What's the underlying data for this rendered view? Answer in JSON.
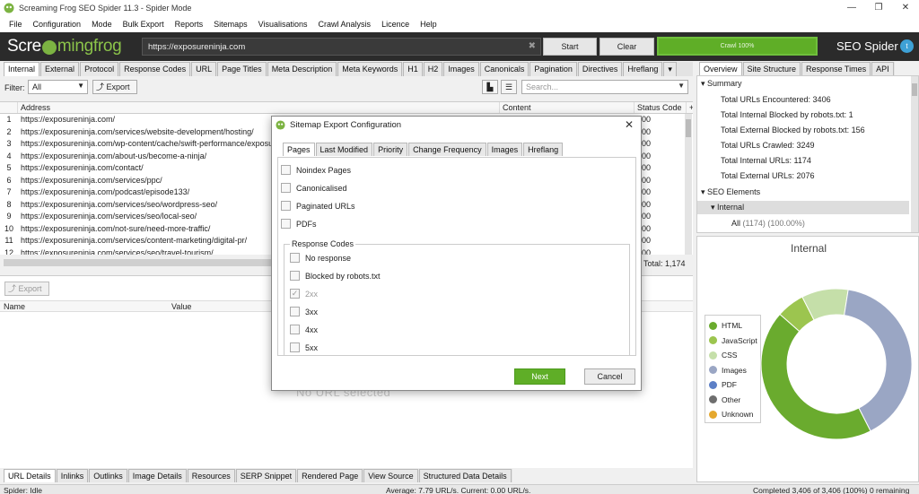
{
  "window": {
    "title": "Screaming Frog SEO Spider 11.3 - Spider Mode",
    "controls": [
      "—",
      "❐",
      "✕"
    ]
  },
  "menu": [
    "File",
    "Configuration",
    "Mode",
    "Bulk Export",
    "Reports",
    "Sitemaps",
    "Visualisations",
    "Crawl Analysis",
    "Licence",
    "Help"
  ],
  "header": {
    "brand_left": "Scre",
    "brand_right": "mingfrog",
    "url": "https://exposureninja.com",
    "start_label": "Start",
    "clear_label": "Clear",
    "progress_label": "Crawl 100%",
    "progress_percent": 100,
    "product_name": "SEO Spider",
    "colors": {
      "accent_green": "#5fae27",
      "header_bg": "#2b2b2b"
    }
  },
  "main_tabs": [
    "Internal",
    "External",
    "Protocol",
    "Response Codes",
    "URL",
    "Page Titles",
    "Meta Description",
    "Meta Keywords",
    "H1",
    "H2",
    "Images",
    "Canonicals",
    "Pagination",
    "Directives",
    "Hreflang"
  ],
  "filter": {
    "label": "Filter:",
    "value": "All",
    "export_label": "Export",
    "search_placeholder": "Search..."
  },
  "table": {
    "columns": [
      "Address",
      "Content",
      "Status Code"
    ],
    "rows": [
      {
        "idx": "1",
        "address": "https://exposureninja.com/",
        "content": "",
        "status": "200"
      },
      {
        "idx": "2",
        "address": "https://exposureninja.com/services/website-development/hosting/",
        "content": "",
        "status": "200"
      },
      {
        "idx": "3",
        "address": "https://exposureninja.com/wp-content/cache/swift-performance/exposureninja.com/",
        "content": "",
        "status": "200"
      },
      {
        "idx": "4",
        "address": "https://exposureninja.com/about-us/become-a-ninja/",
        "content": "",
        "status": "200"
      },
      {
        "idx": "5",
        "address": "https://exposureninja.com/contact/",
        "content": "",
        "status": "200"
      },
      {
        "idx": "6",
        "address": "https://exposureninja.com/services/ppc/",
        "content": "",
        "status": "200"
      },
      {
        "idx": "7",
        "address": "https://exposureninja.com/podcast/episode133/",
        "content": "",
        "status": "200"
      },
      {
        "idx": "8",
        "address": "https://exposureninja.com/services/seo/wordpress-seo/",
        "content": "",
        "status": "200"
      },
      {
        "idx": "9",
        "address": "https://exposureninja.com/services/seo/local-seo/",
        "content": "",
        "status": "200"
      },
      {
        "idx": "10",
        "address": "https://exposureninja.com/not-sure/need-more-traffic/",
        "content": "",
        "status": "200"
      },
      {
        "idx": "11",
        "address": "https://exposureninja.com/services/content-marketing/digital-pr/",
        "content": "",
        "status": "200"
      },
      {
        "idx": "12",
        "address": "https://exposureninja.com/services/seo/travel-tourism/",
        "content": "",
        "status": "200"
      }
    ],
    "total_label": "Total:",
    "total_value": "1,174"
  },
  "lower": {
    "export_label": "Export",
    "col_name": "Name",
    "col_value": "Value",
    "empty_text": "No URL selected"
  },
  "bottom_tabs": [
    "URL Details",
    "Inlinks",
    "Outlinks",
    "Image Details",
    "Resources",
    "SERP Snippet",
    "Rendered Page",
    "View Source",
    "Structured Data Details"
  ],
  "status_bar": {
    "left": "Spider: Idle",
    "middle": "Average: 7.79 URL/s. Current: 0.00 URL/s.",
    "right": "Completed 3,406 of 3,406 (100%) 0 remaining"
  },
  "right_tabs": [
    "Overview",
    "Site Structure",
    "Response Times",
    "API"
  ],
  "overview": {
    "summary_label": "Summary",
    "summary_items": [
      "Total URLs Encountered: 3406",
      "Total Internal Blocked by robots.txt: 1",
      "Total External Blocked by robots.txt: 156",
      "Total URLs Crawled: 3249",
      "Total Internal URLs: 1174",
      "Total External URLs: 2076"
    ],
    "seo_elements_label": "SEO Elements",
    "internal_label": "Internal",
    "all_label": "All",
    "all_count": "(1174) (100.00%)"
  },
  "chart_data": {
    "type": "pie",
    "title": "Internal",
    "categories": [
      "HTML",
      "JavaScript",
      "CSS",
      "Images",
      "PDF",
      "Other",
      "Unknown"
    ],
    "values": [
      44,
      6,
      10,
      40,
      0,
      0,
      0
    ],
    "colors": [
      "#6aab2e",
      "#9cc54f",
      "#c5dfa9",
      "#9aa6c4",
      "#5c7fc6",
      "#6e6e6e",
      "#e5a82e"
    ],
    "legend_position": "left",
    "donut": true
  },
  "modal": {
    "title": "Sitemap Export Configuration",
    "close_label": "✕",
    "tabs": [
      "Pages",
      "Last Modified",
      "Priority",
      "Change Frequency",
      "Images",
      "Hreflang"
    ],
    "page_options": [
      {
        "label": "Noindex Pages",
        "checked": false
      },
      {
        "label": "Canonicalised",
        "checked": false
      },
      {
        "label": "Paginated URLs",
        "checked": false
      },
      {
        "label": "PDFs",
        "checked": false
      }
    ],
    "response_codes_label": "Response Codes",
    "response_options": [
      {
        "label": "No response",
        "checked": false,
        "disabled": false
      },
      {
        "label": "Blocked by robots.txt",
        "checked": false,
        "disabled": false
      },
      {
        "label": "2xx",
        "checked": true,
        "disabled": true
      },
      {
        "label": "3xx",
        "checked": false,
        "disabled": false
      },
      {
        "label": "4xx",
        "checked": false,
        "disabled": false
      },
      {
        "label": "5xx",
        "checked": false,
        "disabled": false
      }
    ],
    "next_label": "Next",
    "cancel_label": "Cancel"
  }
}
